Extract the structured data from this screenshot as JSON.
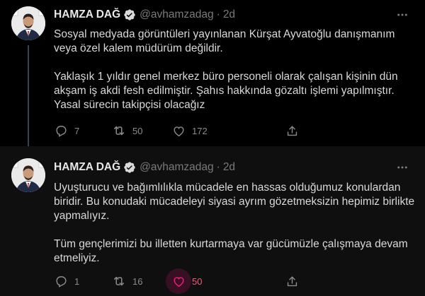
{
  "tweets": [
    {
      "author_name": "HAMZA DAĞ",
      "handle": "@avhamzadag",
      "separator": "·",
      "time": "2d",
      "paragraphs": [
        "Sosyal medyada görüntüleri yayınlanan Kürşat Ayvatoğlu danışmanım veya özel kalem müdürüm değildir.",
        "Yaklaşık 1 yıldır genel merkez büro personeli olarak çalışan kişinin dün akşam iş akdi fesh edilmiştir. Şahıs hakkında gözaltı işlemi yapılmıştır. Yasal sürecin takipçisi olacağız"
      ],
      "reply_count": "7",
      "retweet_count": "50",
      "like_count": "172",
      "liked": false
    },
    {
      "author_name": "HAMZA DAĞ",
      "handle": "@avhamzadag",
      "separator": "·",
      "time": "2d",
      "paragraphs": [
        "Uyuşturucu ve bağımlılıkla mücadele en hassas olduğumuz konulardan biridir. Bu konudaki mücadeleyi siyasi ayrım gözetmeksizin hepimiz birlikte yapmalıyız.",
        "Tüm gençlerimizi bu illetten kurtarmaya var gücümüzle çalışmaya devam etmeliyiz."
      ],
      "reply_count": "1",
      "retweet_count": "16",
      "like_count": "50",
      "liked": true
    }
  ],
  "colors": {
    "background": "#000000",
    "text": "#d9d9d9",
    "muted": "#7a7a7a",
    "verified": "#1d9bf0",
    "like_active": "#f91880"
  },
  "icons": [
    "verified-badge-icon",
    "more-icon",
    "reply-icon",
    "retweet-icon",
    "like-icon",
    "share-icon"
  ]
}
